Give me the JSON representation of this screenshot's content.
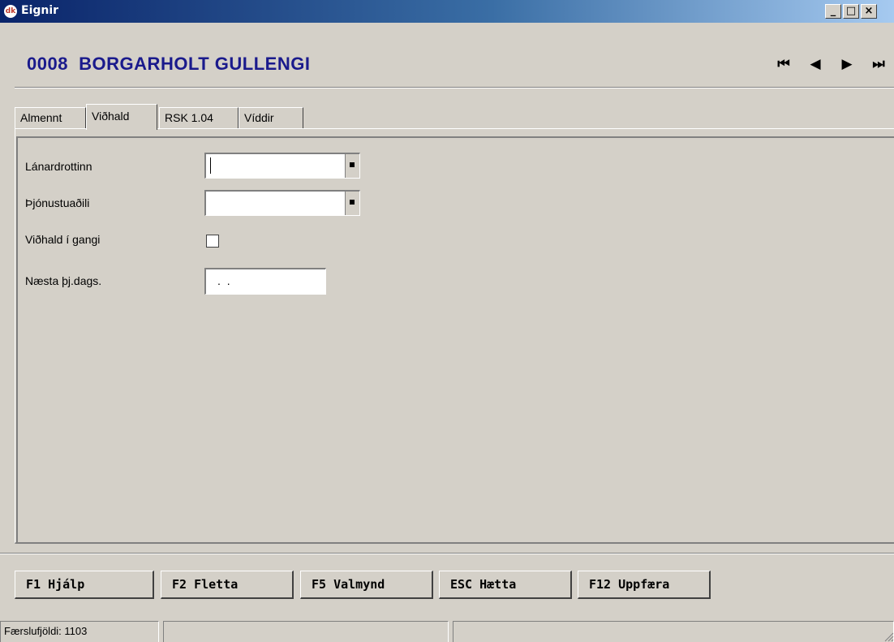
{
  "window": {
    "title": "Eignir",
    "app_icon_text": "dk",
    "controls": {
      "minimize": "_",
      "maximize": "□",
      "close": "×"
    }
  },
  "header": {
    "record_title": "0008  BORGARHOLT GULLENGI",
    "nav": {
      "first": "⏮",
      "prev": "◀",
      "next": "▶",
      "last": "⏭"
    }
  },
  "tabs": [
    {
      "label": "Almennt",
      "active": false
    },
    {
      "label": "Viðhald",
      "active": true
    },
    {
      "label": "RSK 1.04",
      "active": false
    },
    {
      "label": "Víddir",
      "active": false
    }
  ],
  "form": {
    "lender_label": "Lánardrottinn",
    "lender_value": "",
    "service_label": "Þjónustuaðili",
    "service_value": "",
    "maintenance_label": "Viðhald í gangi",
    "maintenance_checked": false,
    "next_date_label": "Næsta þj.dags.",
    "next_date_value": ". ."
  },
  "buttons": {
    "help": "F1 Hjálp",
    "browse": "F2 Fletta",
    "menu": "F5 Valmynd",
    "quit": "ESC Hætta",
    "update": "F12 Uppfæra"
  },
  "status": {
    "record_count": "Færslufjöldi: 1103",
    "panel2": "",
    "panel3": ""
  }
}
